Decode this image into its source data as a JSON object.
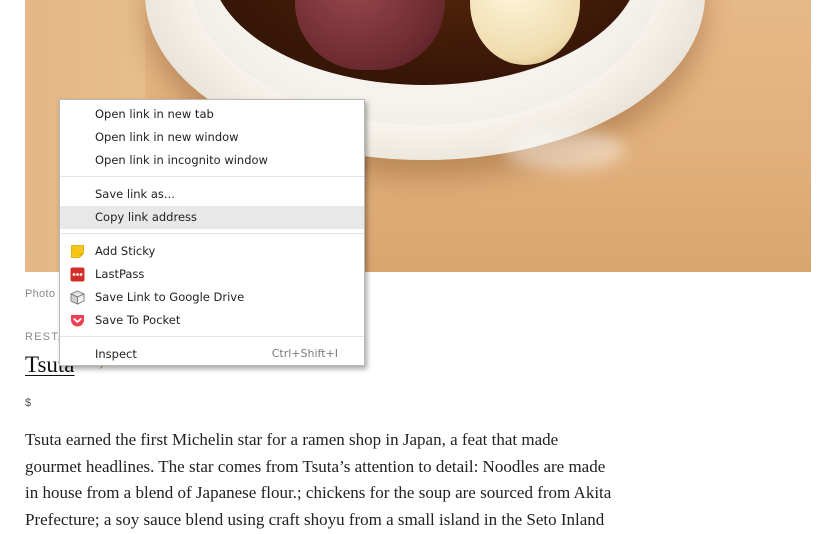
{
  "page": {
    "photo_credit": "Photo",
    "category": "RESTA",
    "title": "Tsuta",
    "title_arrow": "↗",
    "price": "$",
    "body_lines": [
      "Tsuta earned the first Michelin star for a ramen shop in Japan, a feat that made",
      "gourmet headlines. The star comes from Tsuta’s attention to detail: Noodles are made",
      "in house from a blend of Japanese flour.; chickens for the soup are sourced from Akita",
      "Prefecture; a soy sauce blend using craft shoyu from a small island in the Seto Inland"
    ]
  },
  "context_menu": {
    "items": [
      {
        "label": "Open link in new tab"
      },
      {
        "label": "Open link in new window"
      },
      {
        "label": "Open link in incognito window"
      },
      {
        "label": "Save link as..."
      },
      {
        "label": "Copy link address",
        "highlighted": true
      },
      {
        "label": "Add Sticky",
        "icon": "sticky-note-icon",
        "color": "#f5c518"
      },
      {
        "label": "LastPass",
        "icon": "lastpass-icon",
        "color": "#d32d27"
      },
      {
        "label": "Save Link to Google Drive",
        "icon": "google-drive-box-icon",
        "color": "#777777"
      },
      {
        "label": "Save To Pocket",
        "icon": "pocket-icon",
        "color": "#ef4056"
      },
      {
        "label": "Inspect",
        "shortcut": "Ctrl+Shift+I"
      }
    ]
  }
}
